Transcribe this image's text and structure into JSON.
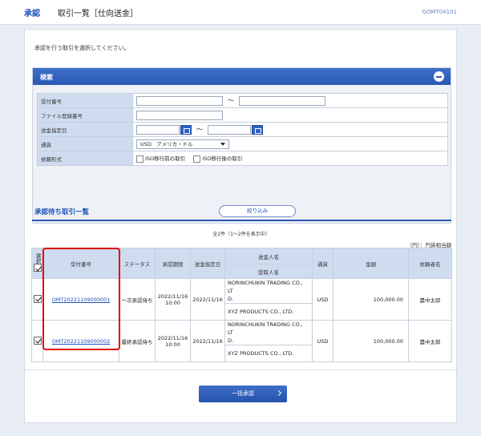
{
  "header": {
    "section": "承認",
    "title": "取引一覧［仕向送金］",
    "screen_id": "GOMT04101"
  },
  "instruction": "承認を行う取引を選択してください。",
  "search": {
    "title": "検索",
    "fields": {
      "receipt_no": "受付番号",
      "file_reg_no": "ファイル登録番号",
      "remit_date": "送金指定日",
      "currency": "通貨",
      "request_type": "依頼形式"
    },
    "tilde": "～",
    "currency_value": "USD　アメリカ・ドル",
    "request_options": [
      "ISO移行前の取引",
      "ISO移行後の取引"
    ],
    "narrow_button": "絞り込み"
  },
  "list": {
    "title": "承認待ち取引一覧",
    "count_text": "全2件（1～2件を表示中）",
    "unit_text": "（円）：円貨相当額",
    "headers": {
      "select": "選択",
      "receipt_no": "受付番号",
      "status": "ステータス",
      "deadline": "承認期限",
      "remit_date": "送金指定日",
      "remitter": "送金人名",
      "beneficiary": "受取人名",
      "currency": "通貨",
      "amount": "金額",
      "requester": "依頼者名"
    },
    "rows": [
      {
        "receipt_no": "OMT20221109000001",
        "status": "一次承認待ち",
        "deadline_date": "2022/11/16",
        "deadline_time": "10:00",
        "remit_date": "2022/11/16",
        "remitter_1": "NORINCHUKIN TRADING CO., LT",
        "remitter_2": "D.",
        "beneficiary": "XYZ PRODUCTS CO., LTD.",
        "currency": "USD",
        "amount": "100,000.00",
        "requester": "農中太郎"
      },
      {
        "receipt_no": "OMT20221109000002",
        "status": "最終承認待ち",
        "deadline_date": "2022/11/16",
        "deadline_time": "10:00",
        "remit_date": "2022/11/16",
        "remitter_1": "NORINCHUKIN TRADING CO., LT",
        "remitter_2": "D.",
        "beneficiary": "XYZ PRODUCTS CO., LTD.",
        "currency": "USD",
        "amount": "100,000.00",
        "requester": "農中太郎"
      }
    ]
  },
  "bulk_button": "一括承認",
  "colors": {
    "accent": "#2a58b3",
    "header_cell": "#cfdcf0",
    "highlight": "#e00000"
  }
}
